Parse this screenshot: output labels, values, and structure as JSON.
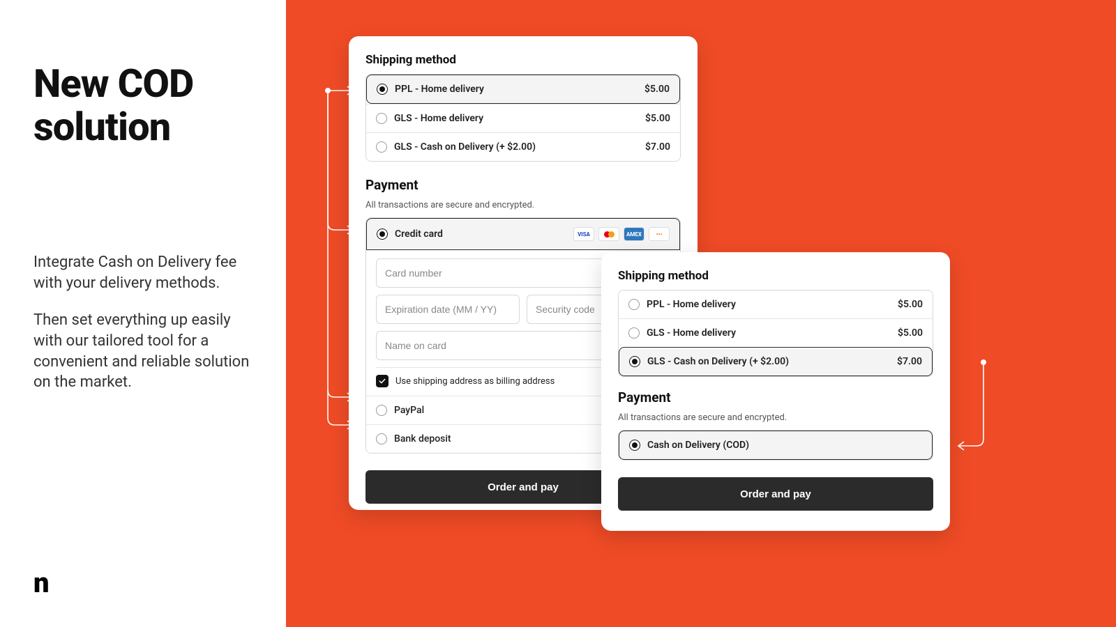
{
  "hero": {
    "title": "New COD solution",
    "paragraph1": "Integrate Cash on Delivery fee with your delivery methods.",
    "paragraph2": "Then set everything up easily with our tailored tool for a convenient and reliable solution on the market.",
    "logo": "n"
  },
  "colors": {
    "accent": "#ef4b26",
    "dark": "#2b2b2b"
  },
  "panelA": {
    "shipping": {
      "title": "Shipping method",
      "options": [
        {
          "label": "PPL - Home delivery",
          "price": "$5.00",
          "selected": true
        },
        {
          "label": "GLS - Home delivery",
          "price": "$5.00",
          "selected": false
        },
        {
          "label": "GLS - Cash on Delivery (+ $2.00)",
          "price": "$7.00",
          "selected": false
        }
      ]
    },
    "payment": {
      "title": "Payment",
      "subtitle": "All transactions are secure and encrypted.",
      "credit_card_label": "Credit card",
      "card_number_placeholder": "Card number",
      "expiry_placeholder": "Expiration date (MM / YY)",
      "cvc_placeholder": "Security code",
      "name_placeholder": "Name on card",
      "billing_checkbox_label": "Use shipping address as billing address",
      "billing_checked": true,
      "alt_methods": [
        {
          "label": "PayPal"
        },
        {
          "label": "Bank deposit"
        }
      ],
      "brands": [
        "visa",
        "mastercard",
        "amex",
        "discover"
      ]
    },
    "cta": "Order and pay"
  },
  "panelB": {
    "shipping": {
      "title": "Shipping method",
      "options": [
        {
          "label": "PPL - Home delivery",
          "price": "$5.00",
          "selected": false
        },
        {
          "label": "GLS - Home delivery",
          "price": "$5.00",
          "selected": false
        },
        {
          "label": "GLS - Cash on Delivery (+ $2.00)",
          "price": "$7.00",
          "selected": true
        }
      ]
    },
    "payment": {
      "title": "Payment",
      "subtitle": "All transactions are secure and encrypted.",
      "cod_label": "Cash on Delivery (COD)"
    },
    "cta": "Order and pay"
  }
}
